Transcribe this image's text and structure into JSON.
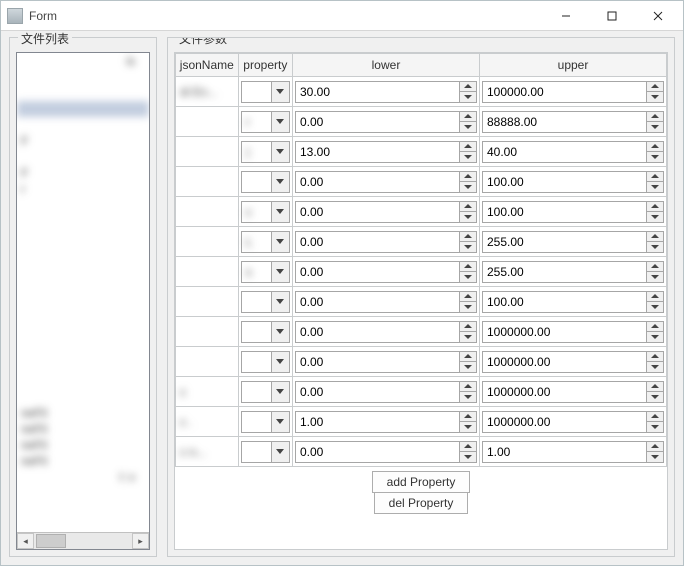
{
  "window": {
    "title": "Form"
  },
  "left_group_label": "文件列表",
  "right_group_label": "文件参数",
  "file_list": {
    "header": "is",
    "items": [
      "",
      "",
      "",
      "",
      "F",
      "",
      "F",
      "r",
      "",
      "",
      "",
      "",
      "",
      "",
      "",
      "",
      "",
      "",
      "",
      "",
      "",
      "neFil",
      "neFil",
      "neFil",
      "neFil"
    ],
    "selected_index": 2,
    "footer": "l: v"
  },
  "table": {
    "headers": {
      "json": "jsonName",
      "property": "property",
      "lower": "lower",
      "upper": "upper"
    },
    "rows": [
      {
        "json": "di            En...",
        "property": "",
        "lower": "30.00",
        "upper": "100000.00"
      },
      {
        "json": "",
        "property": "r",
        "lower": "0.00",
        "upper": "88888.00"
      },
      {
        "json": "",
        "property": ")",
        "lower": "13.00",
        "upper": "40.00"
      },
      {
        "json": "",
        "property": "",
        "lower": "0.00",
        "upper": "100.00"
      },
      {
        "json": "",
        "property": "c",
        "lower": "0.00",
        "upper": "100.00"
      },
      {
        "json": "",
        "property": "L",
        "lower": "0.00",
        "upper": "255.00"
      },
      {
        "json": "",
        "property": "s",
        "lower": "0.00",
        "upper": "255.00"
      },
      {
        "json": "",
        "property": "",
        "lower": "0.00",
        "upper": "100.00"
      },
      {
        "json": "",
        "property": "",
        "lower": "0.00",
        "upper": "1000000.00"
      },
      {
        "json": "",
        "property": "",
        "lower": "0.00",
        "upper": "1000000.00"
      },
      {
        "json": "c",
        "property": "",
        "lower": "0.00",
        "upper": "1000000.00"
      },
      {
        "json": "c                 .",
        "property": "",
        "lower": "1.00",
        "upper": "1000000.00"
      },
      {
        "json": "c            n...",
        "property": "",
        "lower": "0.00",
        "upper": "1.00"
      }
    ]
  },
  "buttons": {
    "add": "add Property",
    "del": "del Property"
  }
}
